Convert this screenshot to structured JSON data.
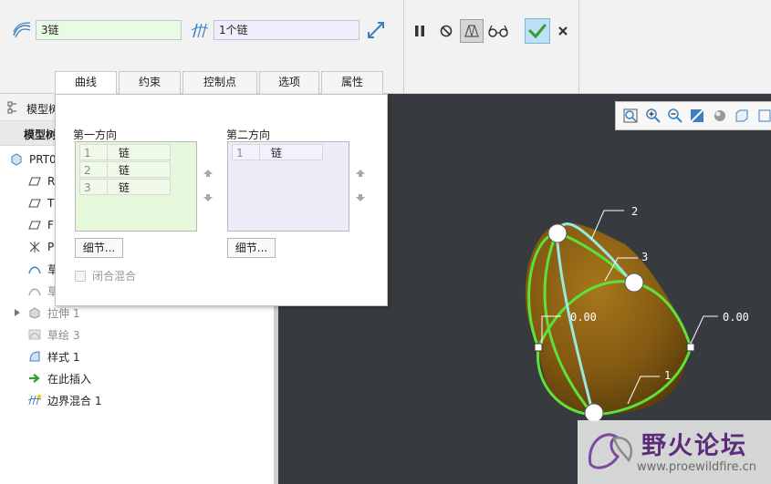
{
  "ribbon": {
    "first_direction_value": "3链",
    "second_direction_value": "1个链",
    "ok_color": "#2f9e2f",
    "accent_color": "#3d7fc1"
  },
  "tabs": [
    {
      "label": "曲线"
    },
    {
      "label": "约束"
    },
    {
      "label": "控制点"
    },
    {
      "label": "选项"
    },
    {
      "label": "属性"
    }
  ],
  "panel": {
    "first_direction": {
      "title": "第一方向",
      "rows": [
        {
          "num": "1",
          "label": "链"
        },
        {
          "num": "2",
          "label": "链"
        },
        {
          "num": "3",
          "label": "链"
        }
      ],
      "details_label": "细节..."
    },
    "second_direction": {
      "title": "第二方向",
      "rows": [
        {
          "num": "1",
          "label": "链"
        }
      ],
      "details_label": "细节..."
    },
    "closed_blend_label": "闭合混合"
  },
  "model_tree": {
    "header_title": "模型树",
    "header2_title": "模型树",
    "items": [
      {
        "label": "PRT0",
        "icon": "part-icon",
        "style": "normal"
      },
      {
        "label": "R",
        "icon": "datum-plane-icon",
        "style": "normal"
      },
      {
        "label": "T",
        "icon": "datum-plane-icon",
        "style": "normal"
      },
      {
        "label": "F",
        "icon": "datum-plane-icon",
        "style": "normal"
      },
      {
        "label": "P",
        "icon": "coordinate-system-icon",
        "style": "normal"
      },
      {
        "label": "草",
        "icon": "sketch-icon",
        "style": "normal"
      },
      {
        "label": "草",
        "icon": "sketch-icon",
        "style": "grey"
      },
      {
        "label": "拉伸 1",
        "icon": "extrude-icon",
        "style": "grey"
      },
      {
        "label": "草绘 3",
        "icon": "sketch-icon",
        "style": "grey"
      },
      {
        "label": "样式 1",
        "icon": "style-icon",
        "style": "normal"
      },
      {
        "label": "在此插入",
        "icon": "insert-arrow-icon",
        "style": "normal"
      },
      {
        "label": "边界混合 1",
        "icon": "boundary-blend-icon",
        "style": "normal"
      }
    ]
  },
  "viewport": {
    "labels": [
      {
        "text": "2"
      },
      {
        "text": "3"
      },
      {
        "text": "0.00"
      },
      {
        "text": "0.00"
      },
      {
        "text": "1"
      }
    ],
    "watermark_cn": "野火论坛",
    "watermark_url": "www.proewildfire.cn"
  }
}
